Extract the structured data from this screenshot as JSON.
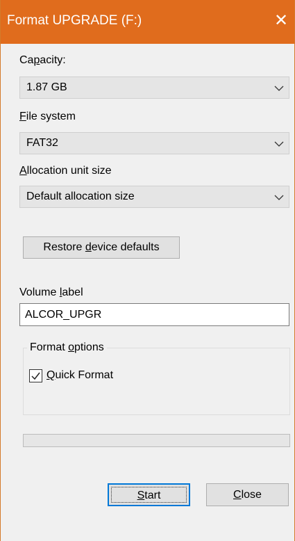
{
  "window": {
    "title": "Format UPGRADE (F:)",
    "title_bar_color": "#e06c1d",
    "close_glyph": "✕"
  },
  "capacity": {
    "label_before": "Ca",
    "label_mnemonic": "p",
    "label_after": "acity:",
    "value": "1.87 GB"
  },
  "file_system": {
    "label_mnemonic": "F",
    "label_after": "ile system",
    "value": "FAT32"
  },
  "allocation": {
    "label_mnemonic": "A",
    "label_after": "llocation unit size",
    "value": "Default allocation size"
  },
  "restore_button": {
    "label_before": "Restore ",
    "label_mnemonic": "d",
    "label_after": "evice defaults"
  },
  "volume": {
    "label_before": "Volume ",
    "label_mnemonic": "l",
    "label_after": "abel",
    "value": "ALCOR_UPGR"
  },
  "format_options": {
    "legend_before": "Format ",
    "legend_mnemonic": "o",
    "legend_after": "ptions",
    "quick_format": {
      "label_mnemonic": "Q",
      "label_after": "uick Format",
      "checked": true
    }
  },
  "progress": {
    "value_fraction": 0.0
  },
  "buttons": {
    "start": {
      "label_mnemonic": "S",
      "label_after": "tart"
    },
    "close": {
      "label_mnemonic": "C",
      "label_after": "lose"
    }
  },
  "icons": {
    "close": "close-icon",
    "dropdown": "chevron-down-icon",
    "check": "checkmark-icon"
  }
}
